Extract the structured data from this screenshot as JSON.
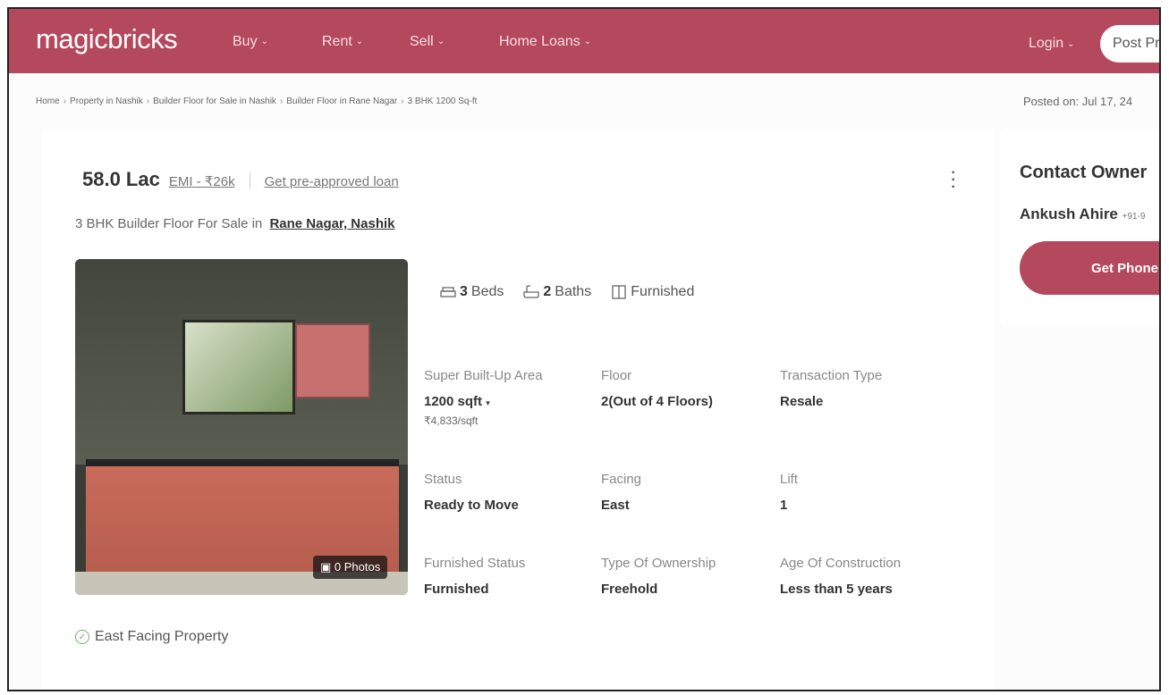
{
  "header": {
    "logo": "magicbricks",
    "nav": [
      {
        "label": "Buy"
      },
      {
        "label": "Rent"
      },
      {
        "label": "Sell"
      },
      {
        "label": "Home Loans"
      }
    ],
    "login": "Login",
    "post_button": "Post Pr"
  },
  "breadcrumb": [
    "Home",
    "Property in Nashik",
    "Builder Floor for Sale in Nashik",
    "Builder Floor in Rane Nagar",
    "3 BHK 1200 Sq-ft"
  ],
  "posted_on": "Posted on: Jul 17, 24",
  "listing": {
    "price": "58.0 Lac",
    "emi": "EMI - ₹26k",
    "loan_link": "Get pre-approved loan",
    "subtitle": "3 BHK Builder Floor For Sale in",
    "location": "Rane Nagar, Nashik",
    "photos_badge": "0 Photos",
    "amenities": [
      {
        "count": "3",
        "label": "Beds",
        "icon": "bed-icon"
      },
      {
        "count": "2",
        "label": "Baths",
        "icon": "bath-icon"
      },
      {
        "count": "",
        "label": "Furnished",
        "icon": "wardrobe-icon"
      }
    ],
    "details": [
      {
        "label": "Super Built-Up Area",
        "value": "1200 sqft",
        "sub": "₹4,833/sqft"
      },
      {
        "label": "Floor",
        "value": "2(Out of 4 Floors)"
      },
      {
        "label": "Transaction Type",
        "value": "Resale"
      },
      {
        "label": "Status",
        "value": "Ready to Move"
      },
      {
        "label": "Facing",
        "value": "East"
      },
      {
        "label": "Lift",
        "value": "1"
      },
      {
        "label": "Furnished Status",
        "value": "Furnished"
      },
      {
        "label": "Type Of Ownership",
        "value": "Freehold"
      },
      {
        "label": "Age Of Construction",
        "value": "Less than 5 years"
      }
    ],
    "facing_note": "East Facing Property"
  },
  "contact": {
    "title": "Contact Owner",
    "owner_name": "Ankush Ahire",
    "owner_phone": "+91-9",
    "button": "Get Phone"
  },
  "colors": {
    "brand": "#b4485c"
  }
}
